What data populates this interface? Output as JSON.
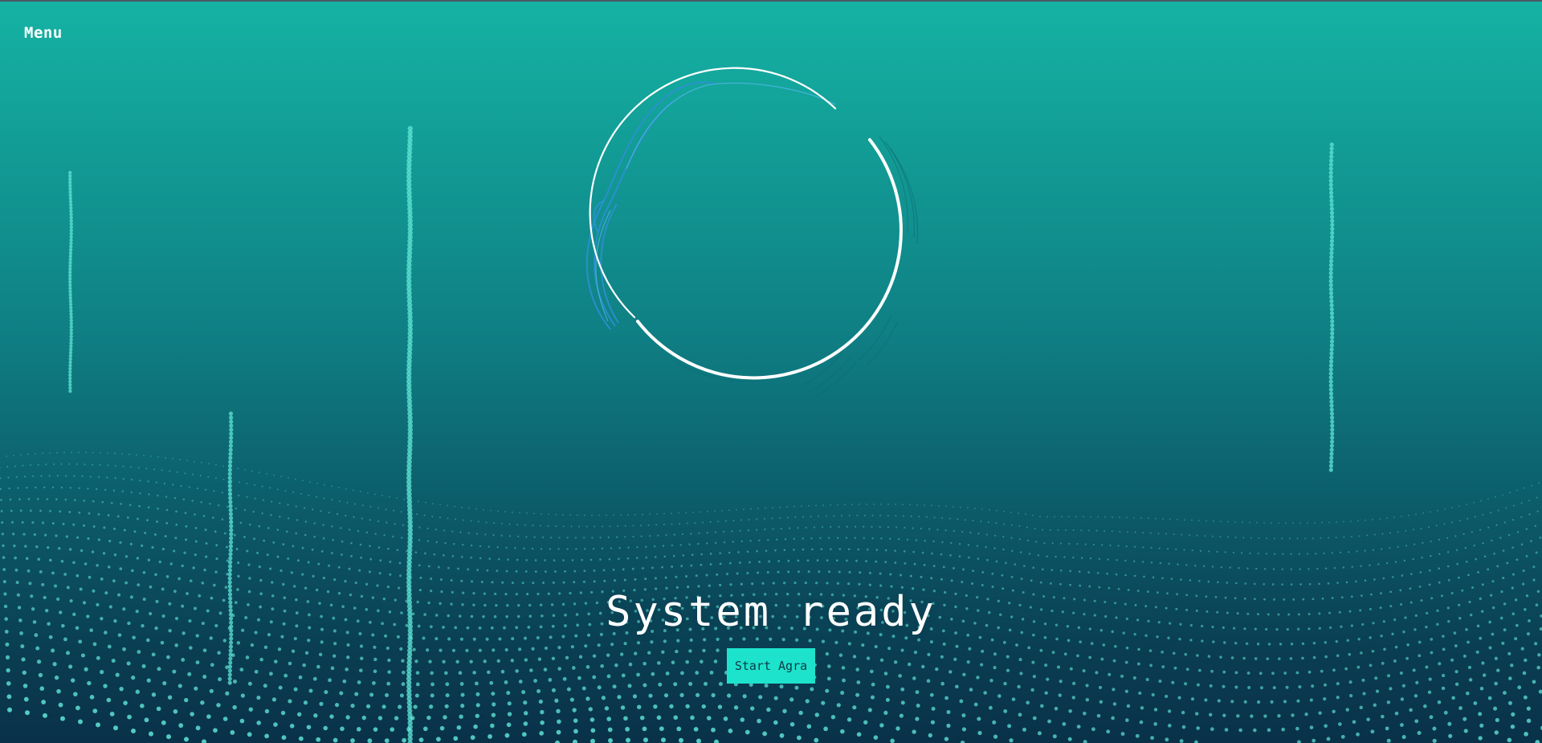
{
  "menu": {
    "label": "Menu"
  },
  "hero": {
    "headline": "System ready",
    "button_label": "Start Agra"
  },
  "colors": {
    "background_top": "#15b3a4",
    "background_bottom": "#09314a",
    "particle": "#5fe6d6",
    "button_bg": "#1de3cc",
    "ring": "#ffffff",
    "ring_accent": "#2f8fd6"
  },
  "icons": [
    "ring-animation-icon",
    "particle-wave-decoration",
    "particle-column-decoration"
  ]
}
